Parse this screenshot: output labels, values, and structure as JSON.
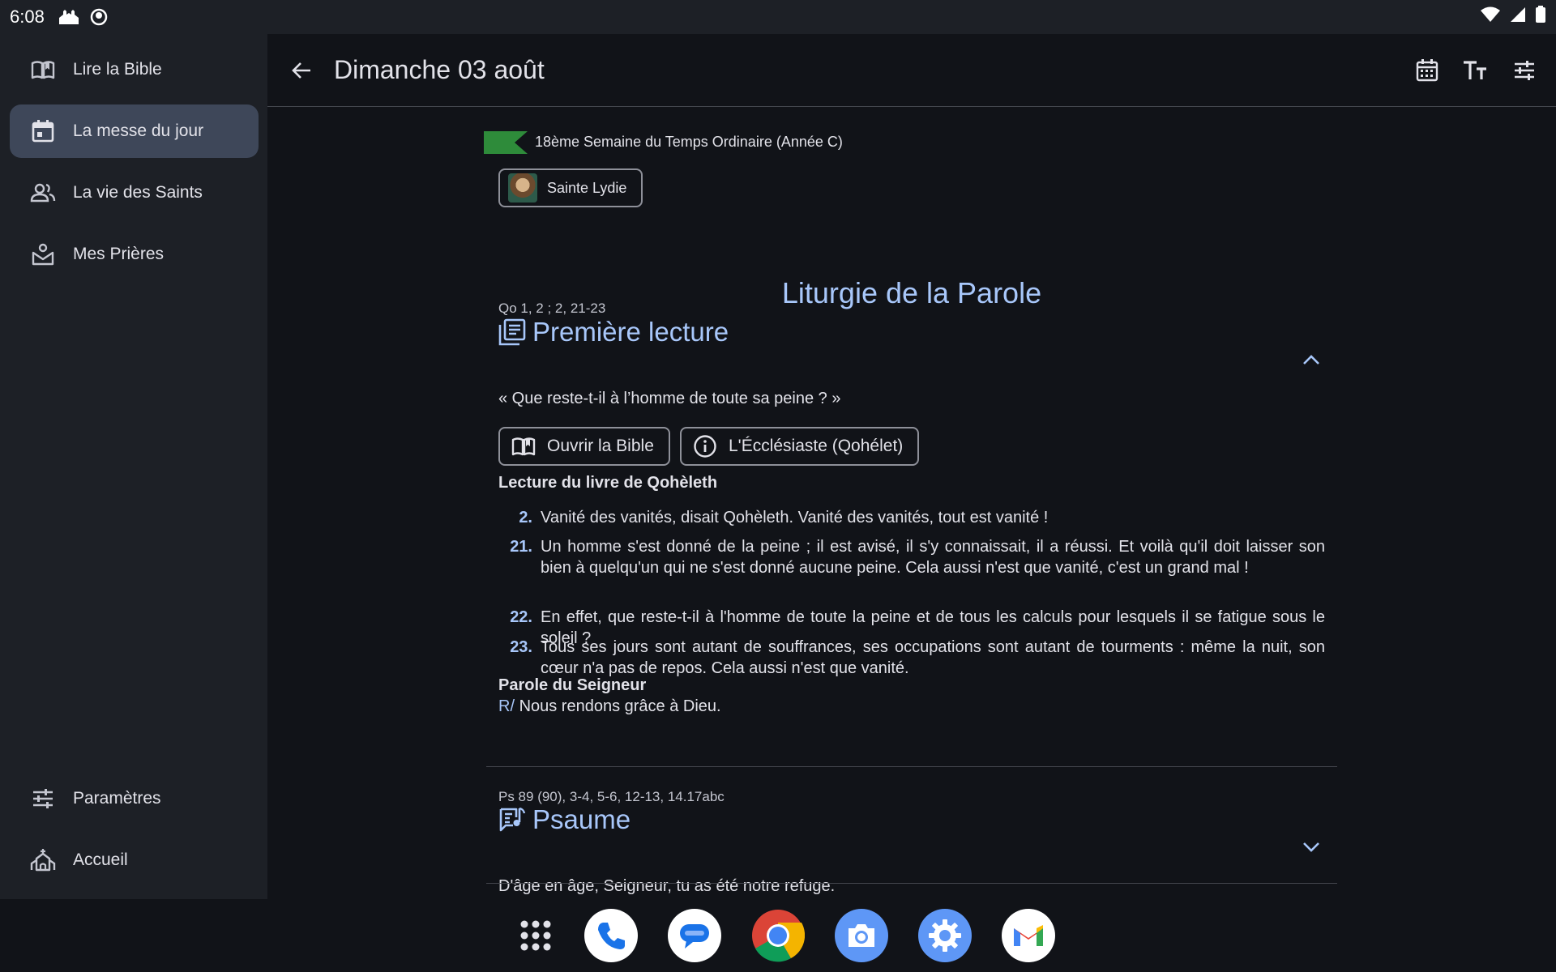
{
  "status_bar": {
    "time": "6:08"
  },
  "sidebar": {
    "items": [
      {
        "label": "Lire la Bible",
        "icon": "book-open-icon"
      },
      {
        "label": "La messe du jour",
        "icon": "calendar-icon",
        "active": true
      },
      {
        "label": "La vie des Saints",
        "icon": "people-icon"
      },
      {
        "label": "Mes Prières",
        "icon": "prayer-hands-icon"
      }
    ],
    "bottom_items": [
      {
        "label": "Paramètres",
        "icon": "settings-sliders-icon"
      },
      {
        "label": "Accueil",
        "icon": "church-icon"
      }
    ]
  },
  "header": {
    "title": "Dimanche 03 août"
  },
  "liturgy": {
    "season": "18ème Semaine du Temps Ordinaire (Année C)",
    "season_color": "#2e8b3a",
    "saint": "Sainte Lydie",
    "section_title": "Liturgie de la Parole"
  },
  "first_reading": {
    "reference": "Qo 1, 2 ; 2, 21-23",
    "title": "Première lecture",
    "subtitle": "« Que reste-t-il à l’homme de toute sa peine ? »",
    "btn_open_bible": "Ouvrir la Bible",
    "btn_book_info": "L'Écclésiaste (Qohélet)",
    "intro": "Lecture du livre de Qohèleth",
    "verses": [
      {
        "num": "2.",
        "text": "Vanité des vanités, disait Qohèleth. Vanité des vanités, tout est vanité !"
      },
      {
        "num": "21.",
        "text": "Un homme s'est donné de la peine ; il est avisé, il s'y connaissait, il a réussi. Et voilà qu'il doit laisser son bien à quelqu'un qui ne s'est donné aucune peine. Cela aussi n'est que vanité, c'est un grand mal !"
      },
      {
        "num": "22.",
        "text": "En effet, que reste-t-il à l'homme de toute la peine et de tous les calculs pour lesquels il se fatigue sous le soleil ?"
      },
      {
        "num": "23.",
        "text": "Tous ses jours sont autant de souffrances, ses occupations sont autant de tourments : même la nuit, son cœur n'a pas de repos. Cela aussi n'est que vanité."
      }
    ],
    "closing": "Parole du Seigneur",
    "response_mark": "R/",
    "response_text": "Nous rendons grâce à Dieu."
  },
  "psalm": {
    "reference": "Ps 89 (90), 3-4, 5-6, 12-13, 14.17abc",
    "title": "Psaume",
    "subtitle": "D'âge en âge, Seigneur, tu as été notre refuge."
  },
  "colors": {
    "accent": "#a8c7fa",
    "active_nav": "#3e4759",
    "surface": "#1d2026",
    "background": "#111318"
  }
}
